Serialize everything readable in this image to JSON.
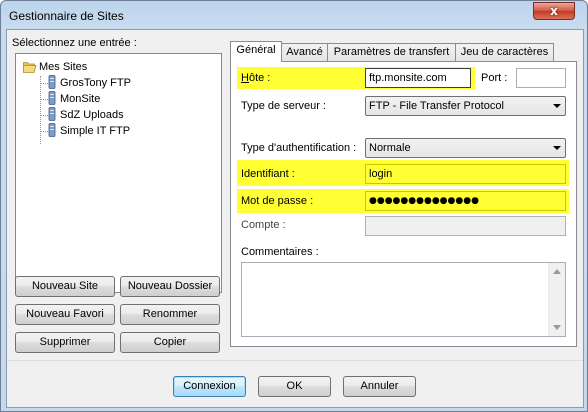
{
  "window": {
    "title": "Gestionnaire de Sites",
    "close_glyph": "x"
  },
  "left": {
    "select_label": "Sélectionnez une entrée :",
    "tree": {
      "root": "Mes Sites",
      "children": [
        "GrosTony FTP",
        "MonSite",
        "SdZ Uploads",
        "Simple IT FTP"
      ]
    },
    "buttons": {
      "new_site": "Nouveau Site",
      "new_folder": "Nouveau Dossier",
      "new_favorite": "Nouveau Favori",
      "rename": "Renommer",
      "delete": "Supprimer",
      "copy": "Copier"
    }
  },
  "tabs": [
    "Général",
    "Avancé",
    "Paramètres de transfert",
    "Jeu de caractères"
  ],
  "general": {
    "host_label": "Hôte :",
    "host_value": "ftp.monsite.com",
    "port_label": "Port :",
    "port_value": "",
    "server_type_label": "Type de serveur :",
    "server_type_value": "FTP - File Transfer Protocol",
    "auth_type_label": "Type d'authentification :",
    "auth_type_value": "Normale",
    "user_label": "Identifiant :",
    "user_value": "login",
    "password_label": "Mot de passe :",
    "password_value": "●●●●●●●●●●●●●●",
    "account_label": "Compte :",
    "account_value": "",
    "comments_label": "Commentaires :"
  },
  "footer": {
    "connect": "Connexion",
    "ok": "OK",
    "cancel": "Annuler"
  },
  "colors": {
    "highlight": "#ffff33",
    "titlebar": "#c8dcf0",
    "close": "#c43a24"
  }
}
